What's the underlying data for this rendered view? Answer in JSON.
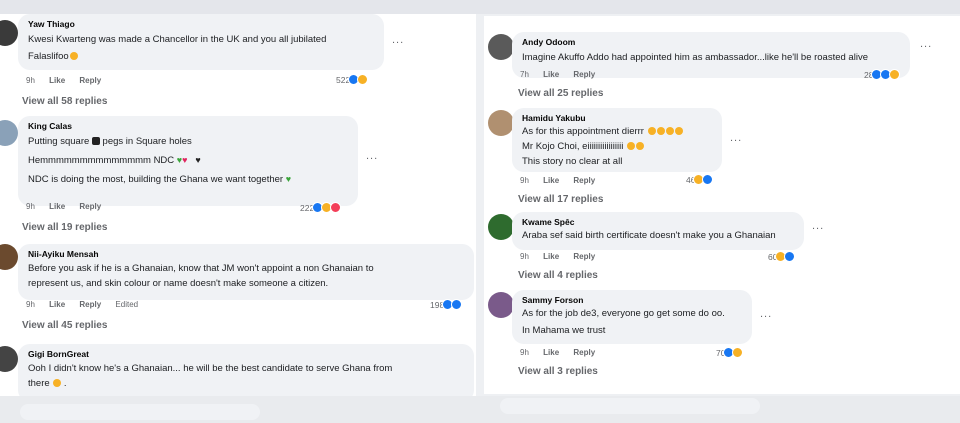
{
  "left_comments": [
    {
      "author": "Yaw Thiago",
      "lines": [
        "Kwesi Kwarteng was made a Chancellor in the UK and you all jubilated",
        "Falaslifoo"
      ],
      "time": "9h",
      "like": "Like",
      "reply": "Reply",
      "react_count": "522",
      "view_replies": "View all 58 replies"
    },
    {
      "author": "King Calas",
      "lines": [
        "Putting square",
        "pegs in Square holes",
        "Hemmmmmmmmmmmmmm NDC",
        "NDC is doing the most, building the Ghana we want together"
      ],
      "time": "9h",
      "like": "Like",
      "reply": "Reply",
      "react_count": "222",
      "view_replies": "View all 19 replies"
    },
    {
      "author": "Nii-Ayiku Mensah",
      "lines": [
        "Before you ask if he is a Ghanaian, know that JM won't appoint a non Ghanaian to",
        "represent us, and skin colour or name doesn't make someone a citizen."
      ],
      "time": "9h",
      "like": "Like",
      "reply": "Reply",
      "edited": "Edited",
      "react_count": "198",
      "view_replies": "View all 45 replies"
    },
    {
      "author": "Gigi BornGreat",
      "lines": [
        "Ooh I didn't know he's a Ghanaian... he will be the best candidate to serve Ghana from",
        "there"
      ]
    }
  ],
  "right_comments": [
    {
      "author": "Andy Odoom",
      "lines": [
        "Imagine Akuffo Addo had appointed him as ambassador...like he'll be roasted alive"
      ],
      "time": "7h",
      "like": "Like",
      "reply": "Reply",
      "react_count": "28",
      "view_replies": "View all 25 replies"
    },
    {
      "author": "Hamidu Yakubu",
      "lines": [
        "As for this appointment dierrr",
        "Mr Kojo Choi, eiiiiiiiiiiiiiiiii",
        "This story no clear at all"
      ],
      "time": "9h",
      "like": "Like",
      "reply": "Reply",
      "react_count": "46",
      "view_replies": "View all 17 replies"
    },
    {
      "author": "Kwame Spêc",
      "lines": [
        "Araba sef said birth certificate doesn't make you a Ghanaian"
      ],
      "time": "9h",
      "like": "Like",
      "reply": "Reply",
      "react_count": "60",
      "view_replies": "View all 4 replies"
    },
    {
      "author": "Sammy Forson",
      "lines": [
        "As for the job de3, everyone go get some do oo.",
        "In Mahama we trust"
      ],
      "time": "9h",
      "like": "Like",
      "reply": "Reply",
      "react_count": "70",
      "view_replies": "View all 3 replies"
    }
  ],
  "more_label": "...",
  "colors": {
    "like": "#1877f2",
    "haha": "#f7b125",
    "love": "#f33e58",
    "bubble": "#f0f2f5",
    "muted": "#65676b"
  }
}
